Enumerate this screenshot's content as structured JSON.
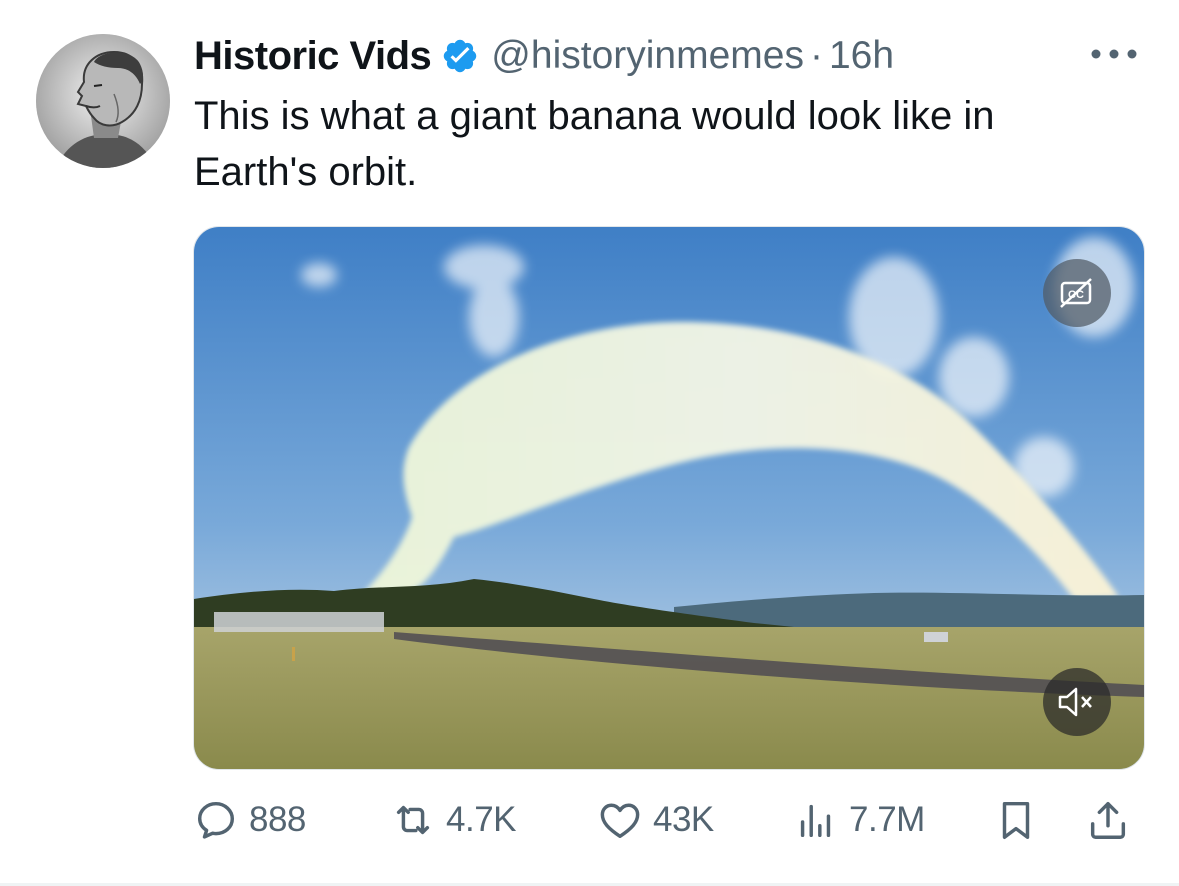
{
  "author": {
    "display_name": "Historic Vids",
    "handle": "@historyinmemes",
    "separator": "·",
    "time": "16h",
    "avatar_icon": "bust-portrait-avatar",
    "verified_icon": "verified-badge-icon"
  },
  "tweet": {
    "text": "This is what a giant banana would look like in Earth's orbit."
  },
  "media": {
    "type": "video",
    "captions_icon": "captions-off-icon",
    "mute_icon": "muted-speaker-icon"
  },
  "actions": {
    "replies": "888",
    "reposts": "4.7K",
    "likes": "43K",
    "views": "7.7M"
  },
  "colors": {
    "text": "#0f1419",
    "secondary": "#536471",
    "verified": "#1d9bf0",
    "sky": "#5b93d0"
  }
}
